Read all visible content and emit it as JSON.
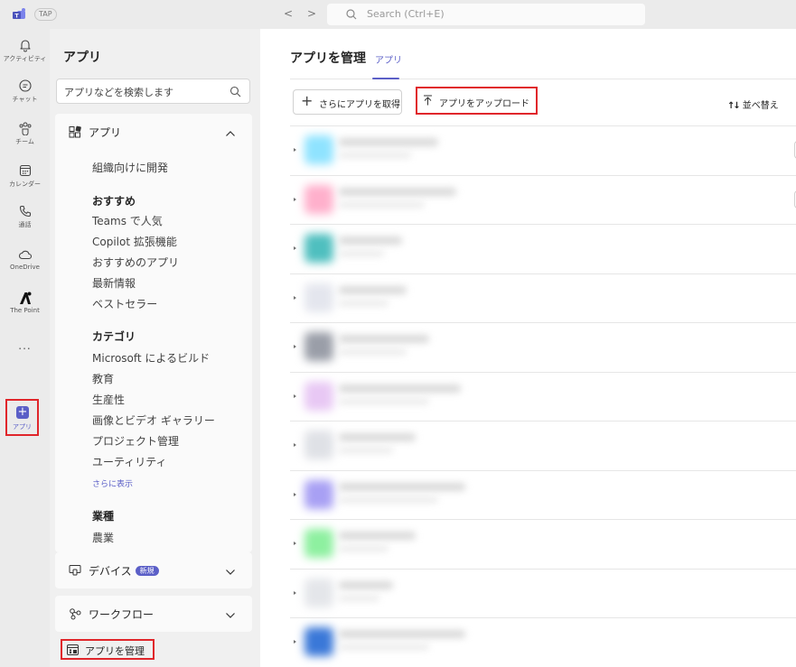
{
  "titlebar": {
    "badge": "TAP",
    "back_arrow": "<",
    "forward_arrow": ">",
    "search_placeholder": "Search (Ctrl+E)"
  },
  "rail": {
    "items": [
      {
        "label": "アクティビティ",
        "icon": "bell-icon"
      },
      {
        "label": "チャット",
        "icon": "chat-icon"
      },
      {
        "label": "チーム",
        "icon": "teams-icon"
      },
      {
        "label": "カレンダー",
        "icon": "calendar-icon"
      },
      {
        "label": "通話",
        "icon": "phone-icon"
      },
      {
        "label": "OneDrive",
        "icon": "cloud-icon"
      },
      {
        "label": "The Point",
        "icon": "the-point-logo-icon"
      }
    ],
    "more": "...",
    "apps_label": "アプリ",
    "apps_symbol": "+"
  },
  "left_panel": {
    "title": "アプリ",
    "search_placeholder": "アプリなどを検索します",
    "apps_section": {
      "label": "アプリ",
      "org_item": "組織向けに開発",
      "recommended_heading": "おすすめ",
      "recommended": [
        "Teams で人気",
        "Copilot 拡張機能",
        "おすすめのアプリ",
        "最新情報",
        "ベストセラー"
      ],
      "category_heading": "カテゴリ",
      "categories": [
        "Microsoft によるビルド",
        "教育",
        "生産性",
        "画像とビデオ ギャラリー",
        "プロジェクト管理",
        "ユーティリティ"
      ],
      "show_more": "さらに表示",
      "industry_heading": "業種",
      "industries": [
        "農業"
      ]
    },
    "devices": {
      "label": "デバイス",
      "badge": "新規"
    },
    "workflows": {
      "label": "ワークフロー"
    },
    "manage": "アプリを管理"
  },
  "main": {
    "title": "アプリを管理",
    "tab": "アプリ",
    "get_more_symbol": "+",
    "get_more": "さらにアプリを取得",
    "upload": "アプリをアップロード",
    "sort_arrows": "↑↓",
    "sort": "並べ替え"
  },
  "colors": {
    "accent": "#5b5fc7",
    "highlight_box": "#e0262b",
    "app_icons": [
      "#8fe3ff",
      "#ffb0cc",
      "#4fbfbf",
      "#e4e6ee",
      "#9a9ea8",
      "#e8c8f4",
      "#dfe1e6",
      "#a8a0f4",
      "#8ef0a0",
      "#e4e6ea",
      "#3a78d8"
    ]
  }
}
